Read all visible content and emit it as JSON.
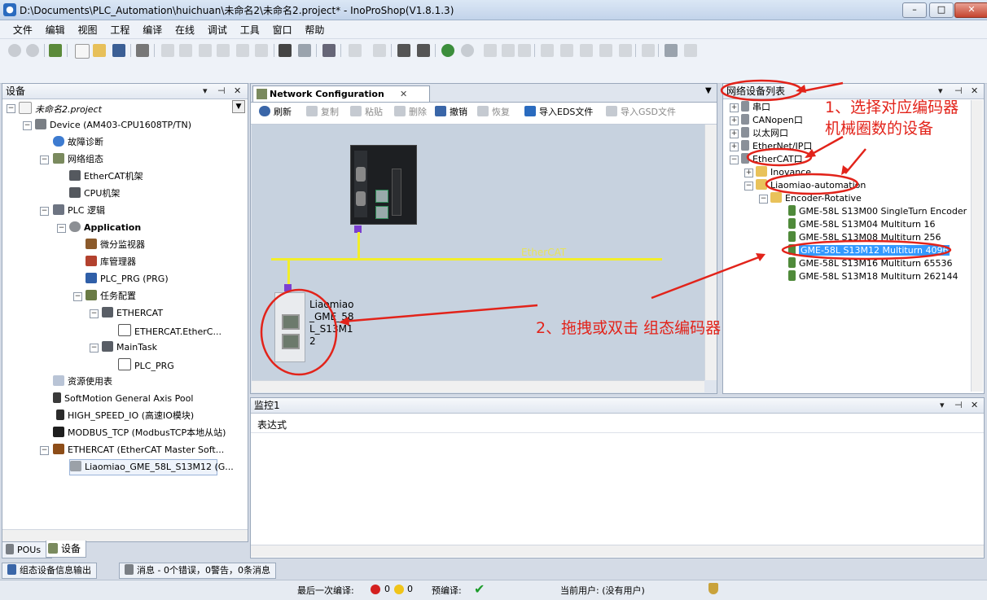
{
  "window": {
    "title": "D:\\Documents\\PLC_Automation\\huichuan\\未命名2\\未命名2.project* - InoProShop(V1.8.1.3)",
    "minimize": "–",
    "maximize": "□",
    "close": "✕"
  },
  "menu": [
    "文件",
    "编辑",
    "视图",
    "工程",
    "编译",
    "在线",
    "调试",
    "工具",
    "窗口",
    "帮助"
  ],
  "devices_panel": {
    "title": "设备",
    "pin": "⊣",
    "close": "✕",
    "dropdown": "▼",
    "tree": [
      {
        "label": "未命名2.project"
      },
      {
        "label": "Device (AM403-CPU1608TP/TN)"
      },
      {
        "label": "故障诊断"
      },
      {
        "label": "网络组态"
      },
      {
        "label": "EtherCAT机架"
      },
      {
        "label": "CPU机架"
      },
      {
        "label": "PLC 逻辑"
      },
      {
        "label": "Application"
      },
      {
        "label": "微分监视器"
      },
      {
        "label": "库管理器"
      },
      {
        "label": "PLC_PRG (PRG)"
      },
      {
        "label": "任务配置"
      },
      {
        "label": "ETHERCAT"
      },
      {
        "label": "ETHERCAT.EtherC..."
      },
      {
        "label": "MainTask"
      },
      {
        "label": "PLC_PRG"
      },
      {
        "label": "资源使用表"
      },
      {
        "label": "SoftMotion General Axis Pool"
      },
      {
        "label": "HIGH_SPEED_IO (高速IO模块)"
      },
      {
        "label": "MODBUS_TCP (ModbusTCP本地从站)"
      },
      {
        "label": "ETHERCAT (EtherCAT Master Soft..."
      },
      {
        "label": "Liaomiao_GME_58L_S13M12 (G..."
      }
    ],
    "tabs": {
      "pous": "POUs",
      "devices": "设备"
    }
  },
  "network_config": {
    "tab_label": "Network Configuration",
    "tab_close": "✕",
    "toolbar": {
      "refresh": "刷新",
      "copy": "复制",
      "paste": "粘贴",
      "delete": "删除",
      "undo": "撤销",
      "redo": "恢复",
      "import_eds": "导入EDS文件",
      "import_gsd": "导入GSD文件"
    },
    "bus_label": "EtherCAT",
    "slave_name": "Liaomiao_GME_58L_S13M12"
  },
  "network_device_list": {
    "title": "网络设备列表",
    "items": [
      {
        "label": "串口"
      },
      {
        "label": "CANopen口"
      },
      {
        "label": "以太网口"
      },
      {
        "label": "EtherNet/IP口"
      },
      {
        "label": "EtherCAT口"
      },
      {
        "label": "Inovance"
      },
      {
        "label": "Liaomiao-automation"
      },
      {
        "label": "Encoder-Rotative"
      },
      {
        "label": "GME-58L S13M00 SingleTurn Encoder"
      },
      {
        "label": "GME-58L S13M04 Multiturn 16"
      },
      {
        "label": "GME-58L S13M08 Multiturn 256"
      },
      {
        "label": "GME-58L S13M12 Multiturn 4096"
      },
      {
        "label": "GME-58L S13M16 Multiturn 65536"
      },
      {
        "label": "GME-58L S13M18 Multiturn 262144"
      }
    ]
  },
  "annotations": {
    "step1_line1": "1、选择对应编码器",
    "step1_line2": "机械圈数的设备",
    "step2": "2、拖拽或双击 组态编码器"
  },
  "monitor_panel": {
    "title": "监控1",
    "column": "表达式"
  },
  "bottom_tabs": {
    "config_output": "组态设备信息输出",
    "messages": "消息 - 0个错误，0警告，0条消息"
  },
  "statusbar": {
    "last_build": "最后一次编译:",
    "errors": "0",
    "warnings": "0",
    "precompile": "预编译:",
    "current_user": "当前用户: (没有用户)"
  },
  "colors": {
    "annotation": "#e2231a",
    "bus": "#f2ee2a",
    "selection": "#3399ff"
  }
}
